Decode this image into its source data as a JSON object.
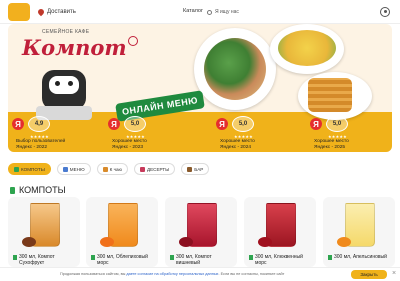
{
  "header": {
    "deliver_label": "Доставить",
    "catalog_label": "Каталог",
    "search_placeholder": "Я ищу",
    "search_text": "нас"
  },
  "banner": {
    "subtitle": "СЕМЕЙНОЕ КАФЕ",
    "brand": "Компот",
    "menu_label": "ОНЛАЙН МЕНЮ",
    "awards": [
      {
        "badge": "Я",
        "rating": "4,9",
        "line1": "Выбор пользователей",
        "line2": "Яндекс - 2022"
      },
      {
        "badge": "Я",
        "rating": "5,0",
        "line1": "Хорошее место",
        "line2": "Яндекс - 2023"
      },
      {
        "badge": "Я",
        "rating": "5,0",
        "line1": "Хорошее место",
        "line2": "Яндекс - 2024"
      },
      {
        "badge": "Я",
        "rating": "5,0",
        "line1": "Хорошее место",
        "line2": "Яндекс - 2025"
      }
    ],
    "stars": "★★★★★"
  },
  "tabs": [
    {
      "label": "КОМПОТЫ",
      "active": true,
      "icon": "cup-icon",
      "color": "#2ea44f"
    },
    {
      "label": "МЕНЮ",
      "active": false,
      "icon": "menu-icon",
      "color": "#4a7bd0"
    },
    {
      "label": "К чаю",
      "active": false,
      "icon": "cake-icon",
      "color": "#d98b2b"
    },
    {
      "label": "ДЕСЕРТЫ",
      "active": false,
      "icon": "dessert-icon",
      "color": "#c73a5b"
    },
    {
      "label": "БАР",
      "active": false,
      "icon": "bar-icon",
      "color": "#8a5a2b"
    }
  ],
  "section_title": "КОМПОТЫ",
  "products": [
    {
      "title1": "300 мл, Компот",
      "title2": "Сухофрукт",
      "color": "#d9892a",
      "fruit": "#7a3a1a"
    },
    {
      "title1": "300 мл, Облепиховый",
      "title2": "морс",
      "color": "#f08a1c",
      "fruit": "#f0701a"
    },
    {
      "title1": "300 мл, Компот",
      "title2": "вишневый",
      "color": "#c4203a",
      "fruit": "#8c1020"
    },
    {
      "title1": "300 мл, Клюквенный",
      "title2": "морс",
      "color": "#b8202e",
      "fruit": "#a0101e"
    },
    {
      "title1": "300 мл, Апельсиновый",
      "title2": "",
      "color": "#f5d96a",
      "fruit": "#f08a1c"
    }
  ],
  "cookie": {
    "text_before": "Продолжая пользоваться сайтом, вы ",
    "link": "даете согласие на обработку персональных данных",
    "text_after": ". Если вы не согласны, покиньте сайт",
    "button": "Закрыть",
    "close": "×"
  },
  "colors": {
    "accent": "#f0b21a",
    "brand": "#c01f3a",
    "menu_green": "#1f8a3e"
  }
}
